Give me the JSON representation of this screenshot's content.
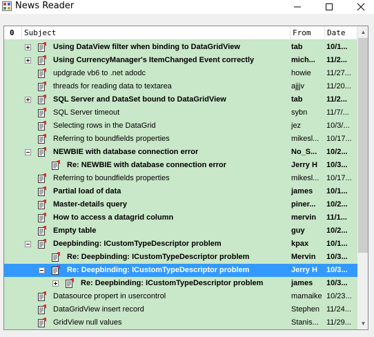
{
  "window": {
    "title": "News Reader"
  },
  "columns": {
    "attachment": "0",
    "subject": "Subject",
    "from": "From",
    "date": "Date"
  },
  "rows": [
    {
      "subject": "Using DataView filter when binding to DataGridView",
      "from": "tab",
      "date": "10/1...",
      "bold": true,
      "level": 0,
      "expander": "plus"
    },
    {
      "subject": "Using CurrencyManager's ItemChanged Event correctly",
      "from": "mich...",
      "date": "11/2...",
      "bold": true,
      "level": 0,
      "expander": "plus"
    },
    {
      "subject": "updgrade vb6 to .net adodc",
      "from": "howie",
      "date": "11/27...",
      "bold": false,
      "level": 0,
      "expander": ""
    },
    {
      "subject": "threads for reading data to textarea",
      "from": "ajjjv",
      "date": "11/20...",
      "bold": false,
      "level": 0,
      "expander": ""
    },
    {
      "subject": "SQL Server and DataSet bound to DataGridView",
      "from": "tab",
      "date": "11/2...",
      "bold": true,
      "level": 0,
      "expander": "plus"
    },
    {
      "subject": "SQL Server timeout",
      "from": "sybn",
      "date": "11/7/...",
      "bold": false,
      "level": 0,
      "expander": ""
    },
    {
      "subject": "Selecting rows in the DataGrid",
      "from": "jez",
      "date": "10/3/...",
      "bold": false,
      "level": 0,
      "expander": ""
    },
    {
      "subject": "Referring to boundfields properties",
      "from": "mikesl...",
      "date": "10/17...",
      "bold": false,
      "level": 0,
      "expander": ""
    },
    {
      "subject": "NEWBIE with database connection error",
      "from": "No_S...",
      "date": "10/2...",
      "bold": true,
      "level": 0,
      "expander": "minus"
    },
    {
      "subject": "Re: NEWBIE with database connection error",
      "from": "Jerry H",
      "date": "10/3...",
      "bold": true,
      "level": 1,
      "expander": ""
    },
    {
      "subject": "Referring to boundfields properties",
      "from": "mikesl...",
      "date": "10/17...",
      "bold": false,
      "level": 0,
      "expander": ""
    },
    {
      "subject": "Partial load of data",
      "from": "james",
      "date": "10/1...",
      "bold": true,
      "level": 0,
      "expander": ""
    },
    {
      "subject": "Master-details query",
      "from": "piner...",
      "date": "10/2...",
      "bold": true,
      "level": 0,
      "expander": ""
    },
    {
      "subject": "How to access a datagrid column",
      "from": "mervin",
      "date": "11/1...",
      "bold": true,
      "level": 0,
      "expander": ""
    },
    {
      "subject": "Empty table",
      "from": "guy",
      "date": "10/2...",
      "bold": true,
      "level": 0,
      "expander": ""
    },
    {
      "subject": "Deepbinding: ICustomTypeDescriptor problem",
      "from": "kpax",
      "date": "10/1...",
      "bold": true,
      "level": 0,
      "expander": "minus"
    },
    {
      "subject": "Re: Deepbinding: ICustomTypeDescriptor problem",
      "from": "Mervin",
      "date": "10/3...",
      "bold": true,
      "level": 1,
      "expander": ""
    },
    {
      "subject": "Re: Deepbinding: ICustomTypeDescriptor problem",
      "from": "Jerry H",
      "date": "10/3...",
      "bold": true,
      "level": 1,
      "expander": "minus",
      "selected": true
    },
    {
      "subject": "Re: Deepbinding: ICustomTypeDescriptor problem",
      "from": "james",
      "date": "10/3...",
      "bold": true,
      "level": 2,
      "expander": "plus"
    },
    {
      "subject": "Datasource propert in usercontrol",
      "from": "mamaike",
      "date": "10/23...",
      "bold": false,
      "level": 0,
      "expander": ""
    },
    {
      "subject": "DataGridView insert record",
      "from": "Stephen",
      "date": "11/24...",
      "bold": false,
      "level": 0,
      "expander": ""
    },
    {
      "subject": "GridView null values",
      "from": "Stanis...",
      "date": "11/29...",
      "bold": false,
      "level": 0,
      "expander": ""
    }
  ],
  "colors": {
    "row_bg": "#c9e7c9",
    "selection": "#3399ff"
  },
  "icons": {
    "app": "app-icon",
    "message": "message-icon"
  }
}
